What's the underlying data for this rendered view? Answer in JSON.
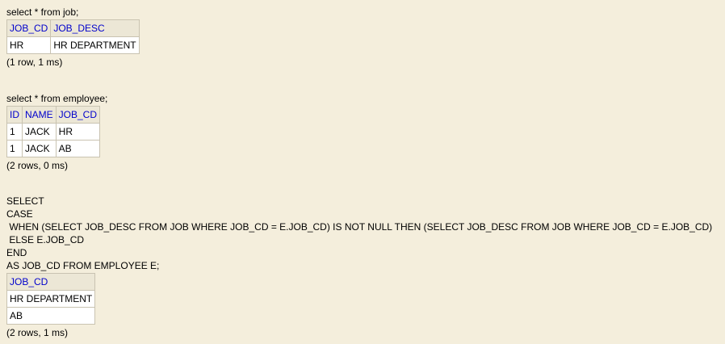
{
  "blocks": [
    {
      "query_lines": [
        "select * from job;"
      ],
      "columns": [
        "JOB_CD",
        "JOB_DESC"
      ],
      "rows": [
        [
          "HR",
          "HR DEPARTMENT"
        ]
      ],
      "status": "(1 row, 1 ms)"
    },
    {
      "query_lines": [
        "select * from employee;"
      ],
      "columns": [
        "ID",
        "NAME",
        "JOB_CD"
      ],
      "rows": [
        [
          "1",
          "JACK",
          "HR"
        ],
        [
          "1",
          "JACK",
          "AB"
        ]
      ],
      "status": "(2 rows, 0 ms)"
    },
    {
      "query_lines": [
        "SELECT",
        "CASE",
        " WHEN (SELECT JOB_DESC FROM JOB WHERE JOB_CD = E.JOB_CD) IS NOT NULL THEN (SELECT JOB_DESC FROM JOB WHERE JOB_CD = E.JOB_CD)",
        " ELSE E.JOB_CD",
        "END",
        "AS JOB_CD FROM EMPLOYEE E;"
      ],
      "columns": [
        "JOB_CD"
      ],
      "rows": [
        [
          "HR DEPARTMENT"
        ],
        [
          "AB"
        ]
      ],
      "status": "(2 rows, 1 ms)"
    }
  ]
}
